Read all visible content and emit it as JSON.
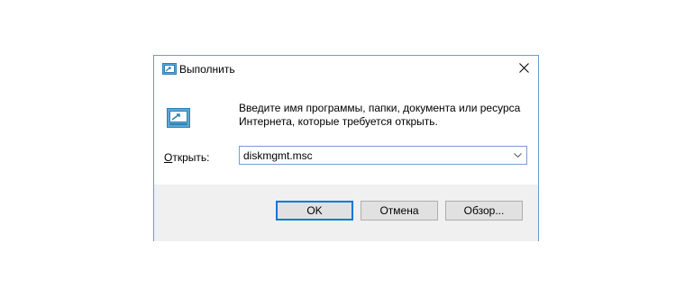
{
  "dialog": {
    "title": "Выполнить",
    "description": "Введите имя программы, папки, документа или ресурса Интернета, которые требуется открыть.",
    "open_label_underlined": "О",
    "open_label_rest": "ткрыть:",
    "open_value": "diskmgmt.msc",
    "buttons": {
      "ok": "OK",
      "cancel": "Отмена",
      "browse": "Обзор..."
    }
  },
  "icons": {
    "title": "run-icon",
    "main": "run-icon",
    "close": "close-icon",
    "dropdown": "chevron-down-icon"
  },
  "colors": {
    "accent": "#0078d7",
    "window_border": "#6a9cd1",
    "footer_bg": "#f0f0f0"
  }
}
